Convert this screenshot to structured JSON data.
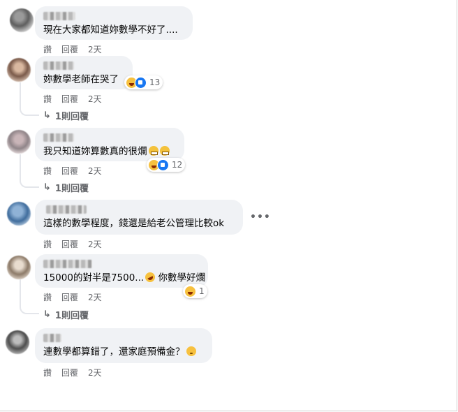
{
  "comments": [
    {
      "text": "現在大家都知道妳數學不好了....",
      "actions": {
        "like": "讚",
        "reply": "回覆",
        "time": "2天"
      }
    },
    {
      "text": "妳數學老師在哭了",
      "reaction_count": "13",
      "reply_summary": "1則回覆",
      "actions": {
        "like": "讚",
        "reply": "回覆",
        "time": "2天"
      }
    },
    {
      "text": "我只知道妳算數真的很爛",
      "reaction_count": "12",
      "reply_summary": "1則回覆",
      "actions": {
        "like": "讚",
        "reply": "回覆",
        "time": "2天"
      }
    },
    {
      "text": "這樣的數學程度，錢還是給老公管理比較ok",
      "more": "•••",
      "actions": {
        "like": "讚",
        "reply": "回覆",
        "time": "2天"
      }
    },
    {
      "text": "15000的對半是7500...",
      "text_suffix": "你數學好爛",
      "reaction_count": "1",
      "reply_summary": "1則回覆",
      "actions": {
        "like": "讚",
        "reply": "回覆",
        "time": "2天"
      }
    },
    {
      "text": "連數學都算錯了，還家庭預備金？",
      "actions": {
        "like": "讚",
        "reply": "回覆",
        "time": "2天"
      }
    }
  ],
  "icons": {
    "reply_arrow": "reply-arrow-icon",
    "haha": "haha-reaction-icon",
    "like": "like-reaction-icon"
  }
}
